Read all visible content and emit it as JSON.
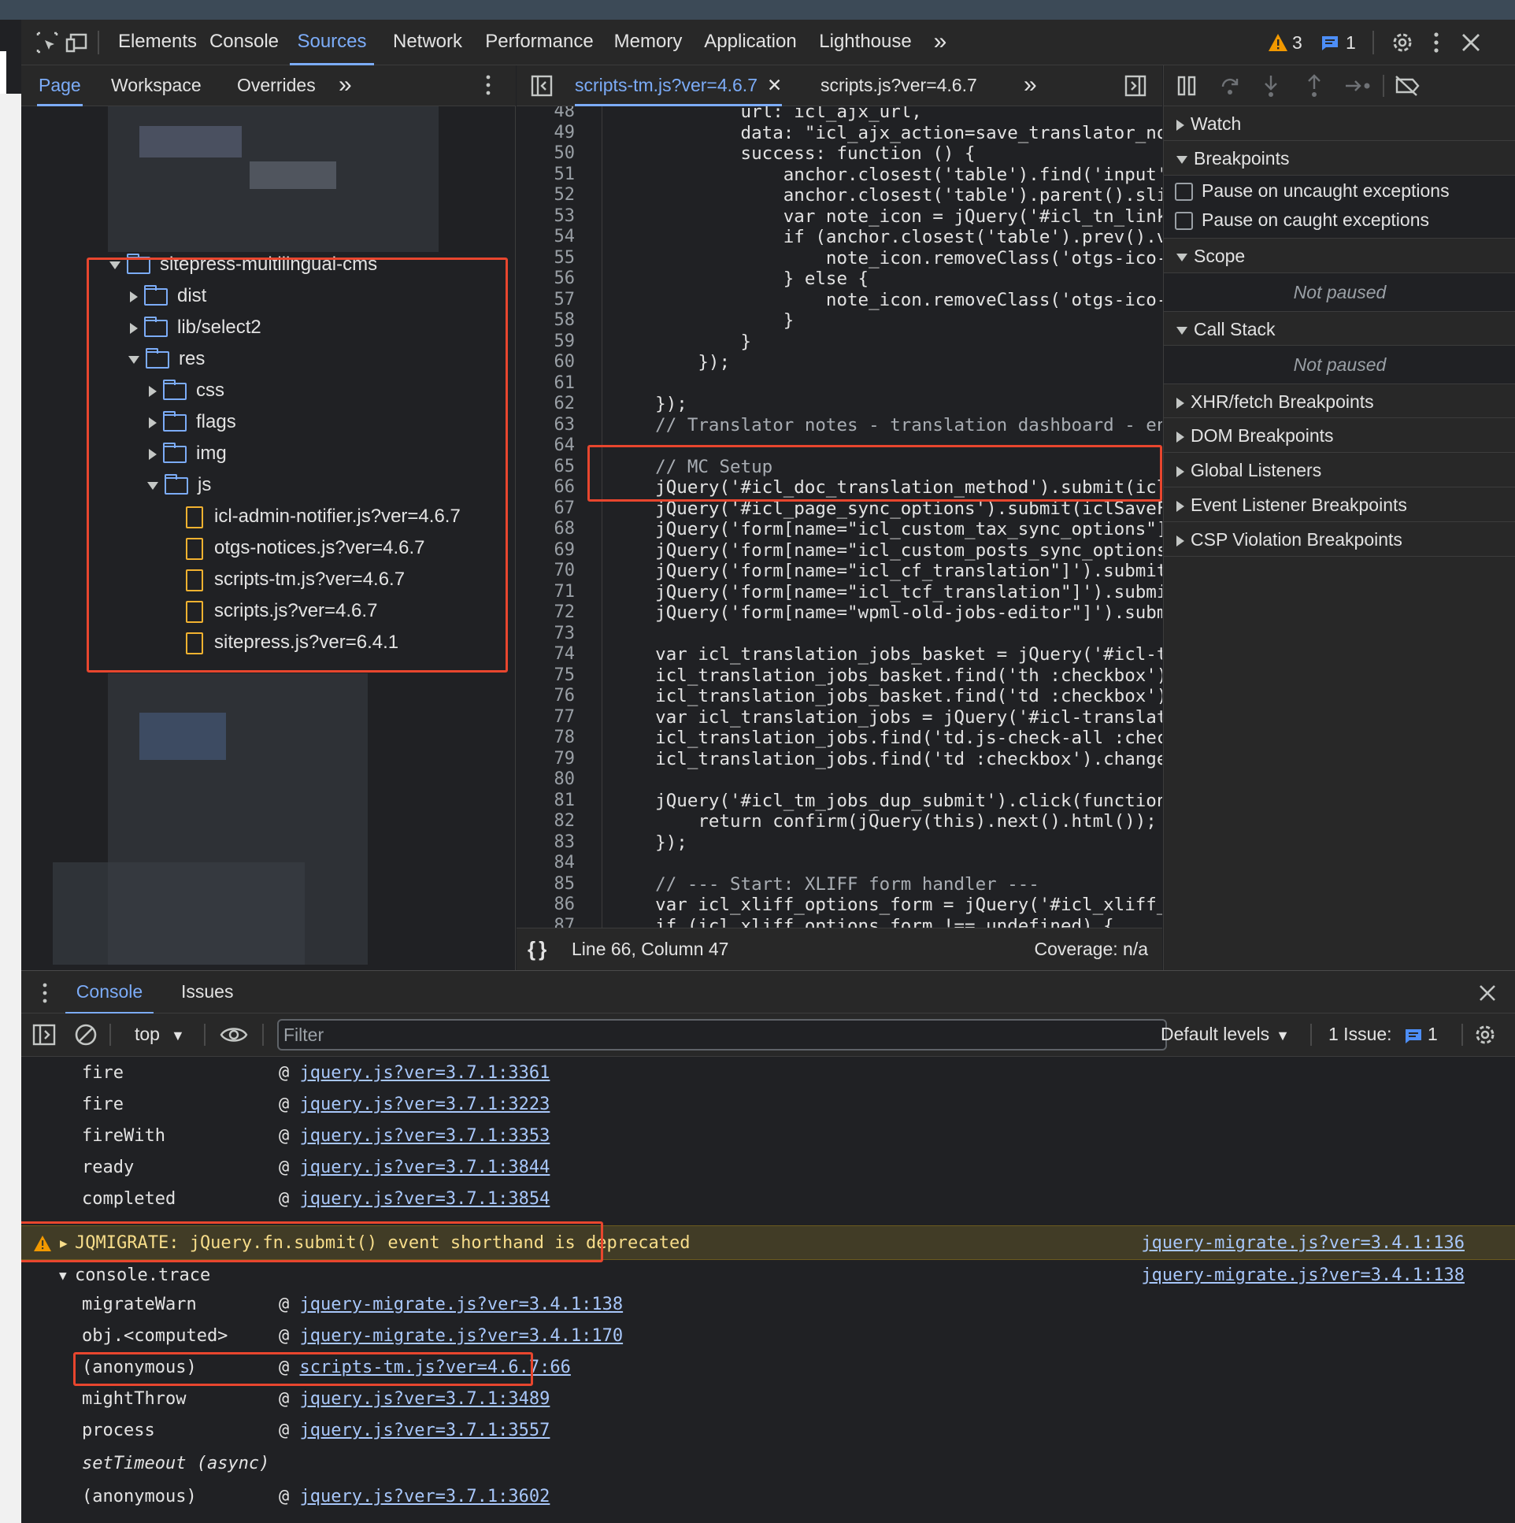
{
  "toolbar": {
    "tabs": [
      "Elements",
      "Console",
      "Sources",
      "Network",
      "Performance",
      "Memory",
      "Application",
      "Lighthouse"
    ],
    "more": "»",
    "warnings_count": "3",
    "messages_count": "1"
  },
  "navigator": {
    "tabs": [
      "Page",
      "Workspace",
      "Overrides"
    ],
    "more": "»",
    "tree": [
      {
        "label": "sitepress-multilingual-cms",
        "type": "folder",
        "open": true
      },
      {
        "label": "dist",
        "type": "folder",
        "open": false
      },
      {
        "label": "lib/select2",
        "type": "folder",
        "open": false
      },
      {
        "label": "res",
        "type": "folder",
        "open": true
      },
      {
        "label": "css",
        "type": "folder",
        "open": false
      },
      {
        "label": "flags",
        "type": "folder",
        "open": false
      },
      {
        "label": "img",
        "type": "folder",
        "open": false
      },
      {
        "label": "js",
        "type": "folder",
        "open": true
      },
      {
        "label": "icl-admin-notifier.js?ver=4.6.7",
        "type": "file"
      },
      {
        "label": "otgs-notices.js?ver=4.6.7",
        "type": "file"
      },
      {
        "label": "scripts-tm.js?ver=4.6.7",
        "type": "file"
      },
      {
        "label": "scripts.js?ver=4.6.7",
        "type": "file"
      },
      {
        "label": "sitepress.js?ver=6.4.1",
        "type": "file"
      }
    ]
  },
  "editor": {
    "tabs": [
      "scripts-tm.js?ver=4.6.7",
      "scripts.js?ver=4.6.7"
    ],
    "more": "»",
    "status": {
      "position": "Line 66, Column 47",
      "coverage": "Coverage: n/a"
    }
  },
  "debugger": {
    "sections": {
      "watch": "Watch",
      "breakpoints": "Breakpoints",
      "pause_uncaught": "Pause on uncaught exceptions",
      "pause_caught": "Pause on caught exceptions",
      "scope": "Scope",
      "scope_note": "Not paused",
      "callstack": "Call Stack",
      "callstack_note": "Not paused",
      "xhr": "XHR/fetch Breakpoints",
      "dom": "DOM Breakpoints",
      "global": "Global Listeners",
      "event": "Event Listener Breakpoints",
      "csp": "CSP Violation Breakpoints"
    }
  },
  "drawer": {
    "tabs": [
      "Console",
      "Issues"
    ],
    "context": "top",
    "filter_placeholder": "Filter",
    "levels": "Default levels",
    "issues_label": "1 Issue:",
    "issues_count": "1"
  },
  "console": {
    "warning": {
      "text": "JQMIGRATE: jQuery.fn.submit() event shorthand is deprecated",
      "source": "jquery-migrate.js?ver=3.4.1:136"
    },
    "trace_label": "console.trace",
    "trace_source": "jquery-migrate.js?ver=3.4.1:138",
    "rows_before": [
      {
        "fn": "fire",
        "at": "@",
        "link": "jquery.js?ver=3.7.1:3361"
      },
      {
        "fn": "fire",
        "at": "@",
        "link": "jquery.js?ver=3.7.1:3223"
      },
      {
        "fn": "fireWith",
        "at": "@",
        "link": "jquery.js?ver=3.7.1:3353"
      },
      {
        "fn": "ready",
        "at": "@",
        "link": "jquery.js?ver=3.7.1:3844"
      },
      {
        "fn": "completed",
        "at": "@",
        "link": "jquery.js?ver=3.7.1:3854"
      }
    ],
    "rows_after": [
      {
        "fn": "migrateWarn",
        "at": "@",
        "link": "jquery-migrate.js?ver=3.4.1:138"
      },
      {
        "fn": "obj.<computed>",
        "at": "@",
        "link": "jquery-migrate.js?ver=3.4.1:170"
      },
      {
        "fn": "(anonymous)",
        "at": "@",
        "link": "scripts-tm.js?ver=4.6.7:66"
      },
      {
        "fn": "mightThrow",
        "at": "@",
        "link": "jquery.js?ver=3.7.1:3489"
      },
      {
        "fn": "process",
        "at": "@",
        "link": "jquery.js?ver=3.7.1:3557"
      },
      {
        "fn": "setTimeout (async)",
        "at": "",
        "link": ""
      },
      {
        "fn": "(anonymous)",
        "at": "@",
        "link": "jquery.js?ver=3.7.1:3602"
      }
    ]
  },
  "code": {
    "lines": [
      {
        "n": "48",
        "t": "            url: icl_ajx_url,"
      },
      {
        "n": "49",
        "t": "            data: \"icl_ajx_action=save_translator_note&no"
      },
      {
        "n": "50",
        "t": "            success: function () {"
      },
      {
        "n": "51",
        "t": "                anchor.closest('table').find('input').pro"
      },
      {
        "n": "52",
        "t": "                anchor.closest('table').parent().slideUp("
      },
      {
        "n": "53",
        "t": "                var note_icon = jQuery('#icl_tn_link_' +"
      },
      {
        "n": "54",
        "t": "                if (anchor.closest('table').prev().val())"
      },
      {
        "n": "55",
        "t": "                    note_icon.removeClass('otgs-ico-note-"
      },
      {
        "n": "56",
        "t": "                } else {"
      },
      {
        "n": "57",
        "t": "                    note_icon.removeClass('otgs-ico-note-"
      },
      {
        "n": "58",
        "t": "                }"
      },
      {
        "n": "59",
        "t": "            }"
      },
      {
        "n": "60",
        "t": "        });"
      },
      {
        "n": "61",
        "t": ""
      },
      {
        "n": "62",
        "t": "    });"
      },
      {
        "n": "63",
        "t": "    // Translator notes - translation dashboard - end"
      },
      {
        "n": "64",
        "t": ""
      },
      {
        "n": "65",
        "t": "    // MC Setup"
      },
      {
        "n": "66",
        "t": "    jQuery('#icl_doc_translation_method').submit(iclSaveF"
      },
      {
        "n": "67",
        "t": "    jQuery('#icl_page_sync_options').submit(iclSaveForm);"
      },
      {
        "n": "68",
        "t": "    jQuery('form[name=\"icl_custom_tax_sync_options\"]').su"
      },
      {
        "n": "69",
        "t": "    jQuery('form[name=\"icl_custom_posts_sync_options\"]')."
      },
      {
        "n": "70",
        "t": "    jQuery('form[name=\"icl_cf_translation\"]').submit(iclS"
      },
      {
        "n": "71",
        "t": "    jQuery('form[name=\"icl_tcf_translation\"]').submit(icl"
      },
      {
        "n": "72",
        "t": "    jQuery('form[name=\"wpml-old-jobs-editor\"]').submit(ic"
      },
      {
        "n": "73",
        "t": ""
      },
      {
        "n": "74",
        "t": "    var icl_translation_jobs_basket = jQuery('#icl-transl"
      },
      {
        "n": "75",
        "t": "    icl_translation_jobs_basket.find('th :checkbox').chan"
      },
      {
        "n": "76",
        "t": "    icl_translation_jobs_basket.find('td :checkbox').chan"
      },
      {
        "n": "77",
        "t": "    var icl_translation_jobs = jQuery('#icl-translation-j"
      },
      {
        "n": "78",
        "t": "    icl_translation_jobs.find('td.js-check-all :checkbox'"
      },
      {
        "n": "79",
        "t": "    icl_translation_jobs.find('td :checkbox').change(upda"
      },
      {
        "n": "80",
        "t": ""
      },
      {
        "n": "81",
        "t": "    jQuery('#icl_tm_jobs_dup_submit').click(function () {"
      },
      {
        "n": "82",
        "t": "        return confirm(jQuery(this).next().html());"
      },
      {
        "n": "83",
        "t": "    });"
      },
      {
        "n": "84",
        "t": ""
      },
      {
        "n": "85",
        "t": "    // --- Start: XLIFF form handler ---"
      },
      {
        "n": "86",
        "t": "    var icl_xliff_options_form = jQuery('#icl_xliff_optio"
      },
      {
        "n": "87",
        "t": "    if (icl_xliff_options_form !== undefined) {"
      }
    ]
  }
}
